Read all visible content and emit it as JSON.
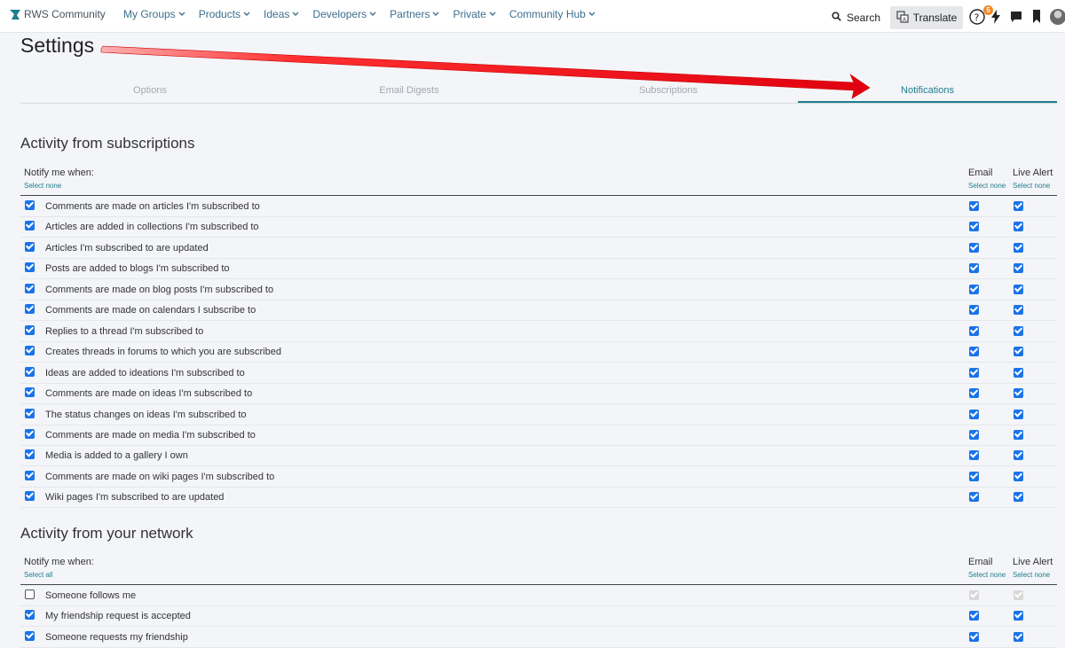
{
  "app": {
    "logo_text": "RWS Community",
    "nav": [
      "My Groups",
      "Products",
      "Ideas",
      "Developers",
      "Partners",
      "Private",
      "Community Hub"
    ],
    "search_label": "Search",
    "translate_label": "Translate",
    "notification_count": "5"
  },
  "page": {
    "title": "Settings",
    "tabs": [
      "Options",
      "Email Digests",
      "Subscriptions",
      "Notifications"
    ],
    "active_tab": "Notifications"
  },
  "section1": {
    "title": "Activity from subscriptions",
    "notify_label": "Notify me when:",
    "select_label": "Select none",
    "email_label": "Email",
    "email_select": "Select none",
    "live_label": "Live Alert",
    "live_select": "Select none",
    "rows": [
      {
        "label": "Comments are made on articles I'm subscribed to",
        "checked": true,
        "email": "on",
        "live": "on"
      },
      {
        "label": "Articles are added in collections I'm subscribed to",
        "checked": true,
        "email": "on",
        "live": "on"
      },
      {
        "label": "Articles I'm subscribed to are updated",
        "checked": true,
        "email": "on",
        "live": "on"
      },
      {
        "label": "Posts are added to blogs I'm subscribed to",
        "checked": true,
        "email": "on",
        "live": "on"
      },
      {
        "label": "Comments are made on blog posts I'm subscribed to",
        "checked": true,
        "email": "on",
        "live": "on"
      },
      {
        "label": "Comments are made on calendars I subscribe to",
        "checked": true,
        "email": "on",
        "live": "on"
      },
      {
        "label": "Replies to a thread I'm subscribed to",
        "checked": true,
        "email": "on",
        "live": "on"
      },
      {
        "label": "Creates threads in forums to which you are subscribed",
        "checked": true,
        "email": "on",
        "live": "on"
      },
      {
        "label": "Ideas are added to ideations I'm subscribed to",
        "checked": true,
        "email": "on",
        "live": "on"
      },
      {
        "label": "Comments are made on ideas I'm subscribed to",
        "checked": true,
        "email": "on",
        "live": "on"
      },
      {
        "label": "The status changes on ideas I'm subscribed to",
        "checked": true,
        "email": "on",
        "live": "on"
      },
      {
        "label": "Comments are made on media I'm subscribed to",
        "checked": true,
        "email": "on",
        "live": "on"
      },
      {
        "label": "Media is added to a gallery I own",
        "checked": true,
        "email": "on",
        "live": "on"
      },
      {
        "label": "Comments are made on wiki pages I'm subscribed to",
        "checked": true,
        "email": "on",
        "live": "on"
      },
      {
        "label": "Wiki pages I'm subscribed to are updated",
        "checked": true,
        "email": "on",
        "live": "on"
      }
    ]
  },
  "section2": {
    "title": "Activity from your network",
    "notify_label": "Notify me when:",
    "select_label": "Select all",
    "email_label": "Email",
    "email_select": "Select none",
    "live_label": "Live Alert",
    "live_select": "Select none",
    "rows": [
      {
        "label": "Someone follows me",
        "checked": false,
        "email": "dis",
        "live": "dis"
      },
      {
        "label": "My friendship request is accepted",
        "checked": true,
        "email": "on",
        "live": "on"
      },
      {
        "label": "Someone requests my friendship",
        "checked": true,
        "email": "on",
        "live": "on"
      }
    ]
  },
  "colors": {
    "accent": "#1f7d8c",
    "checkbox": "#1a73e8",
    "arrow": "#e8141c"
  }
}
